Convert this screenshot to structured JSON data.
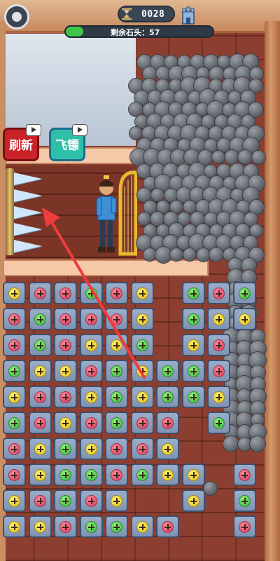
{
  "hud": {
    "level": "0028",
    "remaining_label": "剩余石头：57",
    "remaining_count": 57,
    "progress_fraction": 0.12,
    "settings_icon": "gear-icon",
    "timer_icon": "hourglass-icon",
    "castle_icon": "castle-icon"
  },
  "buttons": {
    "refresh_label": "刷新",
    "skip_label": "飞镖",
    "ad_icon": "video-icon"
  },
  "colors": {
    "yellow": "#f2d62a",
    "red": "#e24a6a",
    "green": "#4ccb45",
    "tile": "#8ea3c2",
    "refresh": "#c9232a",
    "skip": "#2fbfa8",
    "arrow": "#ef3b3b"
  },
  "board": {
    "rows": [
      [
        "Y",
        "R",
        "R",
        "G",
        "R",
        "Y",
        ".",
        "G",
        "R",
        "G"
      ],
      [
        "R",
        "G",
        "R",
        "R",
        "R",
        "Y",
        ".",
        "G",
        "Y",
        "Y"
      ],
      [
        "R",
        "G",
        "R",
        "Y",
        "Y",
        "G",
        ".",
        "Y",
        "R",
        "."
      ],
      [
        "G",
        "Y",
        "Y",
        "R",
        "G",
        "Y",
        "G",
        "G",
        "R",
        "."
      ],
      [
        "Y",
        "R",
        "R",
        "Y",
        "G",
        "Y",
        "G",
        "G",
        "Y",
        "."
      ],
      [
        "G",
        "R",
        "Y",
        "R",
        "G",
        "R",
        "R",
        ".",
        "G",
        "."
      ],
      [
        "R",
        "Y",
        "G",
        "Y",
        "R",
        "R",
        "Y",
        ".",
        ".",
        "."
      ],
      [
        "R",
        "Y",
        "G",
        "G",
        "R",
        "G",
        "Y",
        "Y",
        ".",
        "R"
      ],
      [
        "Y",
        "R",
        "G",
        "R",
        "Y",
        ".",
        ".",
        "Y",
        ".",
        "G"
      ],
      [
        "Y",
        "Y",
        "R",
        "G",
        "G",
        "Y",
        "R",
        ".",
        ".",
        "R"
      ]
    ],
    "legend": {
      "Y": "yellow-screw",
      "R": "red-screw",
      "G": "green-screw",
      ".": "empty"
    }
  }
}
